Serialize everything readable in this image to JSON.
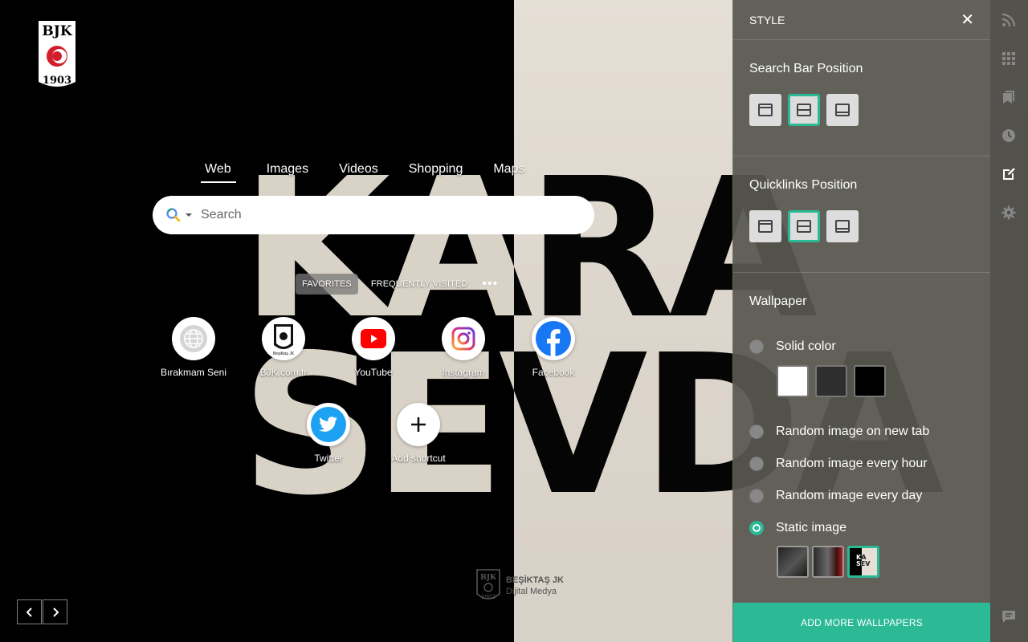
{
  "search": {
    "tabs": [
      "Web",
      "Images",
      "Videos",
      "Shopping",
      "Maps"
    ],
    "active_tab": "Web",
    "placeholder": "Search"
  },
  "quicklinks": {
    "tabs": [
      "FAVORITES",
      "FREQUENTLY VISITED"
    ],
    "active_tab": "FAVORITES",
    "items": [
      {
        "label": "Bırakmam Seni",
        "icon": "globe-icon"
      },
      {
        "label": "BJK.com.tr",
        "icon": "bjk-crest-icon"
      },
      {
        "label": "YouTube",
        "icon": "youtube-icon"
      },
      {
        "label": "Instagram",
        "icon": "instagram-icon"
      },
      {
        "label": "Facebook",
        "icon": "facebook-icon"
      },
      {
        "label": "Twitter",
        "icon": "twitter-icon"
      },
      {
        "label": "Add shortcut",
        "icon": "plus-icon"
      }
    ]
  },
  "wallpaper_text": {
    "line1": "KARA",
    "line2": "SEVDA"
  },
  "logo": {
    "top": "BJK",
    "bottom": "1903"
  },
  "credit": {
    "line1": "BEŞİKTAŞ JK",
    "line2": "Dijital Medya"
  },
  "panel": {
    "title": "STYLE",
    "search_bar_position": {
      "heading": "Search Bar Position",
      "selected": "middle"
    },
    "quicklinks_position": {
      "heading": "Quicklinks Position",
      "selected": "middle"
    },
    "wallpaper": {
      "heading": "Wallpaper",
      "options": [
        "Solid color",
        "Random image on new tab",
        "Random image every hour",
        "Random image every day",
        "Static image"
      ],
      "selected": "Static image",
      "solid_colors": [
        "#ffffff",
        "#2e2e2e",
        "#000000"
      ],
      "thumbs": [
        "dark-photo-1",
        "dark-photo-2",
        "kara-sevda"
      ],
      "selected_thumb": 2
    },
    "add_button": "ADD MORE WALLPAPERS"
  },
  "rail_icons": [
    "rss-icon",
    "apps-grid-icon",
    "bookmarks-icon",
    "history-icon",
    "style-edit-icon",
    "settings-gear-icon",
    "feedback-icon"
  ],
  "colors": {
    "accent": "#2bb996",
    "panel": "#585750"
  }
}
